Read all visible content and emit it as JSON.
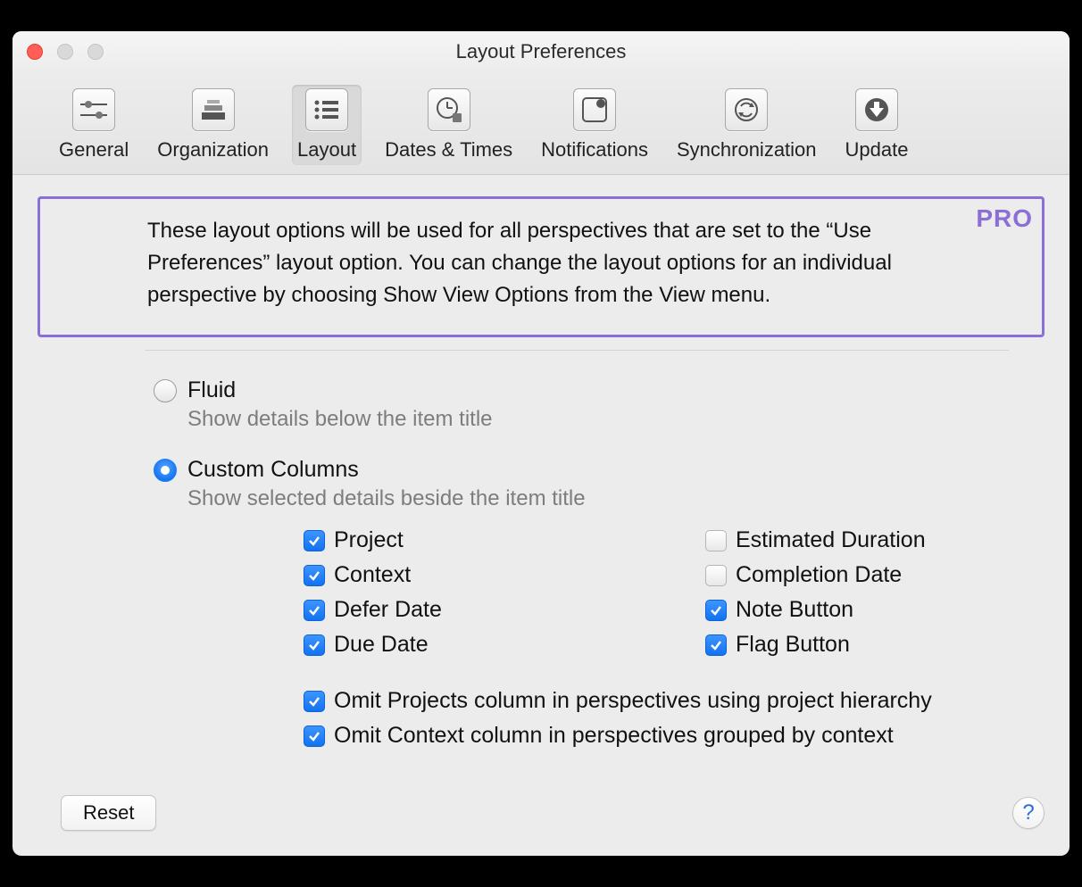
{
  "window": {
    "title": "Layout Preferences"
  },
  "toolbar": {
    "items": [
      {
        "label": "General"
      },
      {
        "label": "Organization"
      },
      {
        "label": "Layout"
      },
      {
        "label": "Dates & Times"
      },
      {
        "label": "Notifications"
      },
      {
        "label": "Synchronization"
      },
      {
        "label": "Update"
      }
    ],
    "active_index": 2
  },
  "callout": {
    "badge": "PRO",
    "text": "These layout options will be used for all perspectives that are set to the “Use Preferences” layout option. You can change the layout options for an individual perspective by choosing Show View Options from the View menu."
  },
  "layout_mode": {
    "fluid": {
      "label": "Fluid",
      "description": "Show details below the item title",
      "selected": false
    },
    "custom": {
      "label": "Custom Columns",
      "description": "Show selected details beside the item title",
      "selected": true
    }
  },
  "columns": {
    "left": [
      {
        "label": "Project",
        "checked": true
      },
      {
        "label": "Context",
        "checked": true
      },
      {
        "label": "Defer Date",
        "checked": true
      },
      {
        "label": "Due Date",
        "checked": true
      }
    ],
    "right": [
      {
        "label": "Estimated Duration",
        "checked": false
      },
      {
        "label": "Completion Date",
        "checked": false
      },
      {
        "label": "Note Button",
        "checked": true
      },
      {
        "label": "Flag Button",
        "checked": true
      }
    ]
  },
  "omit_options": [
    {
      "label": "Omit Projects column in perspectives using project hierarchy",
      "checked": true
    },
    {
      "label": "Omit Context column in perspectives grouped by context",
      "checked": true
    }
  ],
  "footer": {
    "reset_label": "Reset",
    "help_label": "?"
  }
}
